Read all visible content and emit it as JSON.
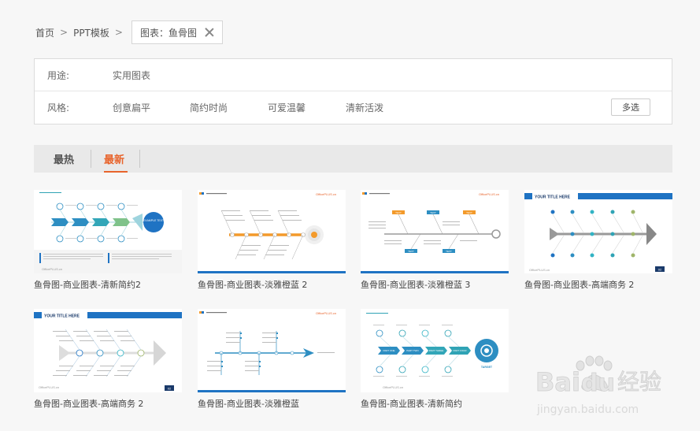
{
  "breadcrumb": {
    "home": "首页",
    "sep1": ">",
    "category": "PPT模板",
    "sep2": ">",
    "tag_label": "图表：鱼骨图"
  },
  "filters": {
    "usage_label": "用途:",
    "usage_option": "实用图表",
    "style_label": "风格:",
    "style_options": [
      "创意扁平",
      "简约时尚",
      "可爱温馨",
      "清新活泼"
    ],
    "multi_select": "多选"
  },
  "sort_tabs": {
    "hot": "最热",
    "new": "最新",
    "active": "new"
  },
  "cards": [
    {
      "title": "鱼骨图-商业图表-清新简约2"
    },
    {
      "title": "鱼骨图-商业图表-淡雅橙蓝 2"
    },
    {
      "title": "鱼骨图-商业图表-淡雅橙蓝 3"
    },
    {
      "title": "鱼骨图-商业图表-高端商务 2"
    },
    {
      "title": "鱼骨图-商业图表-高端商务 2"
    },
    {
      "title": "鱼骨图-商业图表-淡雅橙蓝"
    },
    {
      "title": "鱼骨图-商业图表-清新简约"
    }
  ],
  "thumb_text": {
    "brand": "OfficePLUS.cn",
    "your_title": "YOUR TITLE HERE",
    "text_box": "TEXT",
    "target": "TARGET",
    "page_num": "02",
    "part_one": "PART ONE",
    "part_two": "PART TWO",
    "part_three": "PART THREE",
    "part_four": "PART FOUR",
    "example_text": "EXAMPLE TEXT"
  },
  "watermark": {
    "brand": "Bai",
    "brand2": "du",
    "cn": "经验",
    "url": "jingyan.baidu.com"
  },
  "colors": {
    "accent_orange": "#e8642c",
    "blue": "#1f73c3",
    "teal": "#2fa3b5",
    "orange": "#f39a2b"
  }
}
